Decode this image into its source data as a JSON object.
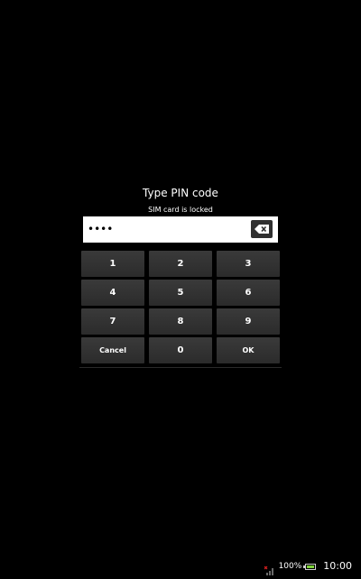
{
  "dialog": {
    "title": "Type PIN code",
    "subtitle": "SIM card is locked",
    "pin_masked": "••••"
  },
  "keypad": {
    "rows": [
      [
        "1",
        "2",
        "3"
      ],
      [
        "4",
        "5",
        "6"
      ],
      [
        "7",
        "8",
        "9"
      ],
      [
        "Cancel",
        "0",
        "OK"
      ]
    ]
  },
  "status_bar": {
    "battery_percent": "100%",
    "battery_level": 1.0,
    "time": "10:00",
    "icons": [
      "no-sim-signal-icon",
      "battery-icon"
    ]
  },
  "colors": {
    "background": "#000000",
    "key_bg": "#333333",
    "battery_green": "#7fd43a",
    "no_sim_red": "#e02020"
  }
}
